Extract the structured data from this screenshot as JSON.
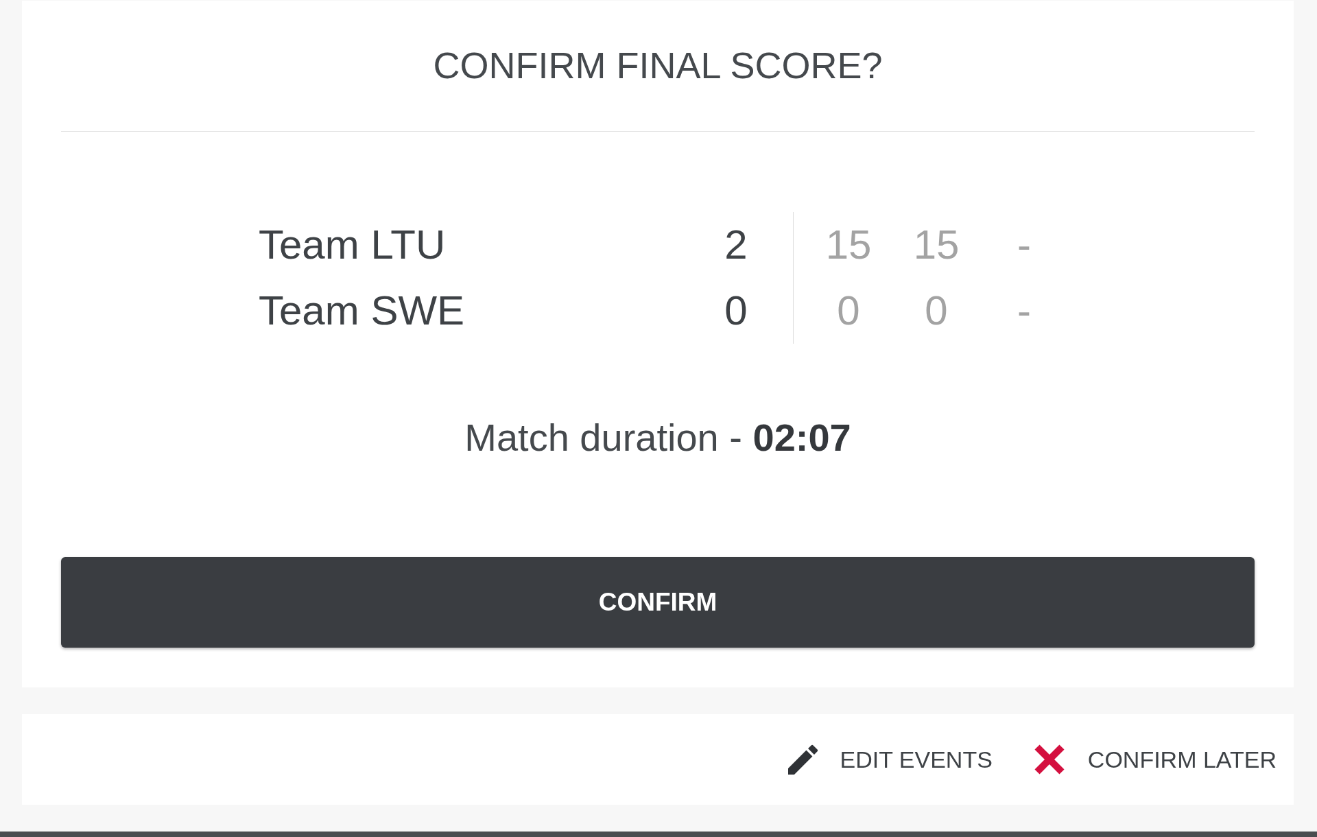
{
  "dialog": {
    "title": "CONFIRM FINAL SCORE?"
  },
  "teams": [
    {
      "name": "Team LTU",
      "score": "2",
      "sets": [
        "15",
        "15",
        "-"
      ]
    },
    {
      "name": "Team SWE",
      "score": "0",
      "sets": [
        "0",
        "0",
        "-"
      ]
    }
  ],
  "duration": "Match duration - **02:07**",
  "confirm_button": "CONFIRM",
  "actions": [
    {
      "kind": "edit",
      "label": "EDIT EVENTS"
    },
    {
      "kind": "cancel",
      "label": "CONFIRM LATER"
    }
  ]
}
